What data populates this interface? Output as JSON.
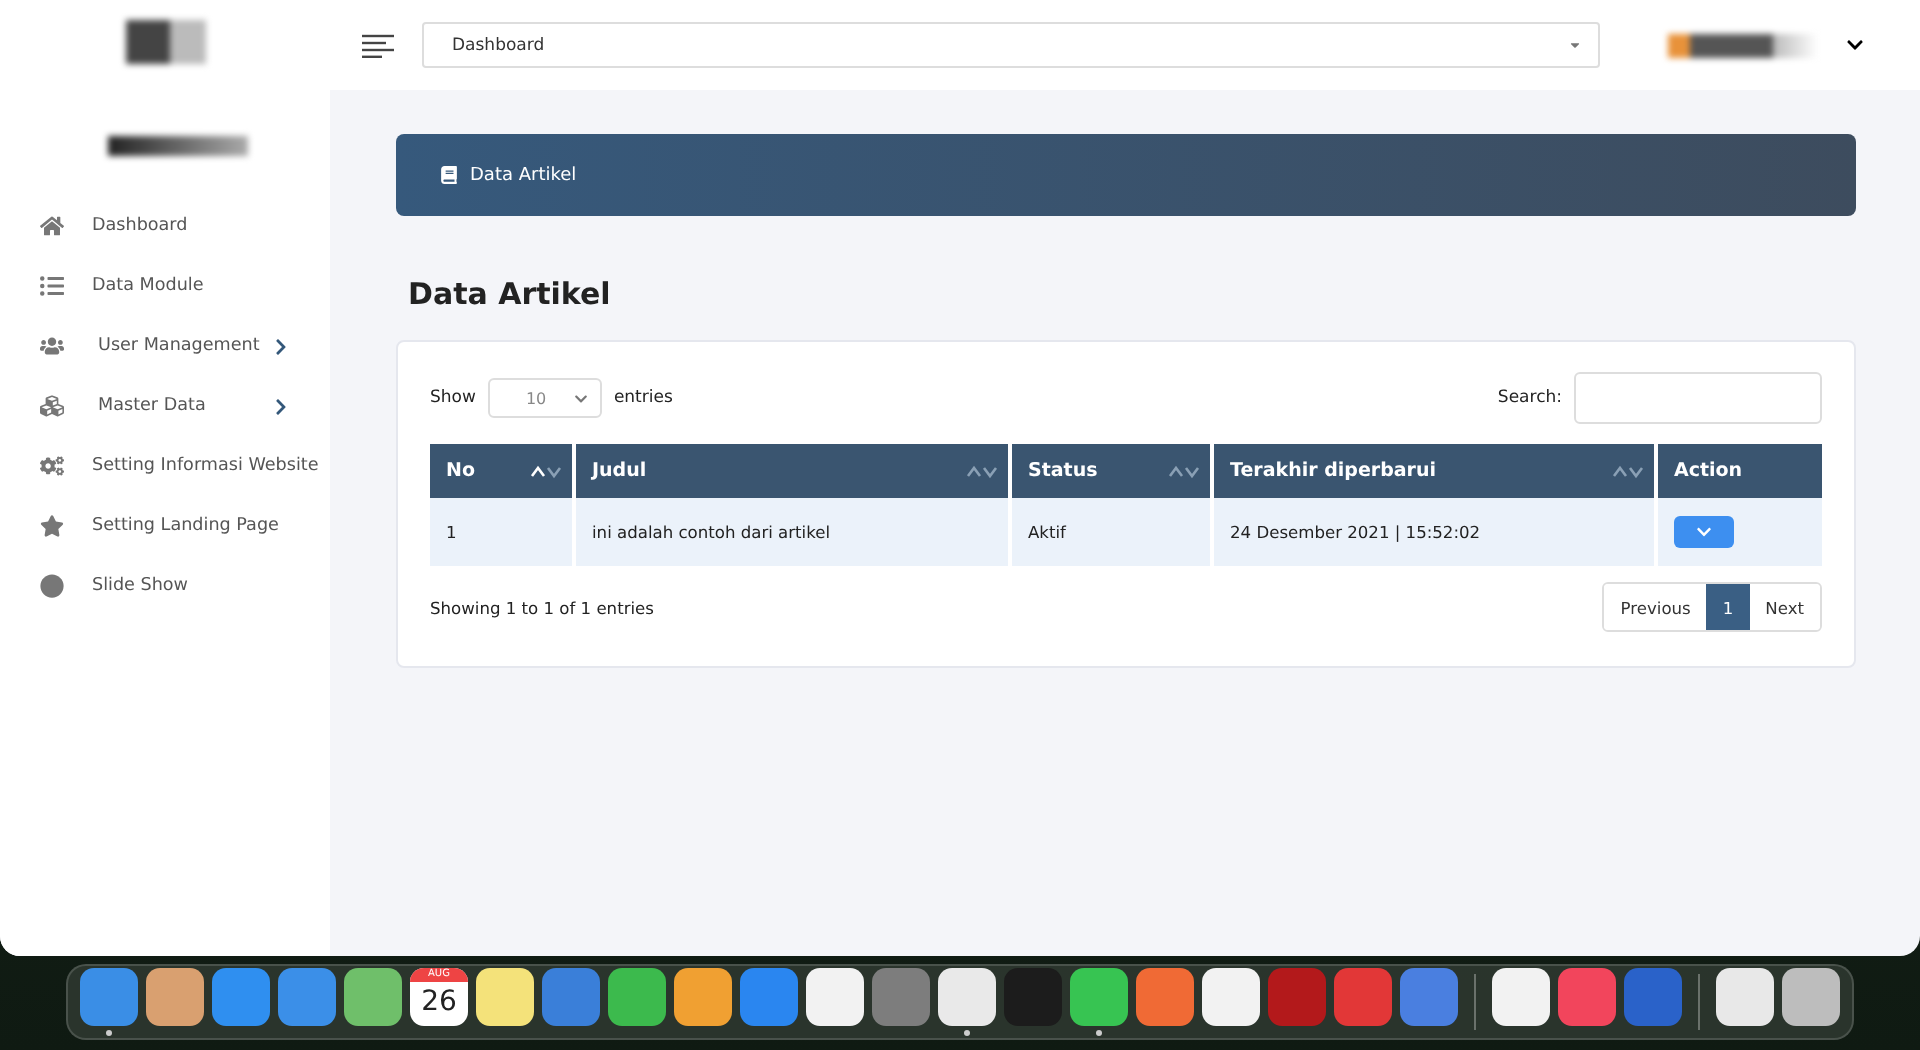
{
  "topbar": {
    "page_select": "Dashboard"
  },
  "sidebar": {
    "items": [
      {
        "label": "Dashboard",
        "has_submenu": false
      },
      {
        "label": "Data Module",
        "has_submenu": false
      },
      {
        "label": "User Management",
        "has_submenu": true
      },
      {
        "label": "Master Data",
        "has_submenu": true
      },
      {
        "label": "Setting Informasi Website",
        "has_submenu": false
      },
      {
        "label": "Setting Landing Page",
        "has_submenu": false
      },
      {
        "label": "Slide Show",
        "has_submenu": false
      }
    ]
  },
  "breadcrumb": {
    "label": "Data Artikel"
  },
  "heading": "Data Artikel",
  "table_controls": {
    "show_label": "Show",
    "page_size": "10",
    "entries_label": "entries",
    "search_label": "Search:"
  },
  "table": {
    "columns": [
      {
        "label": "No",
        "sortable": true,
        "sorted": true
      },
      {
        "label": "Judul",
        "sortable": true,
        "sorted": false
      },
      {
        "label": "Status",
        "sortable": true,
        "sorted": false
      },
      {
        "label": "Terakhir diperbarui",
        "sortable": true,
        "sorted": false
      },
      {
        "label": "Action",
        "sortable": false
      }
    ],
    "rows": [
      [
        "1",
        "ini adalah contoh dari artikel",
        "Aktif",
        "24 Desember 2021 | 15:52:02"
      ]
    ]
  },
  "info": "Showing 1 to 1 of 1 entries",
  "pagination": [
    {
      "label": "Previous",
      "selected": false
    },
    {
      "label": "1",
      "selected": true
    },
    {
      "label": "Next",
      "selected": false
    }
  ],
  "dock": {
    "groups": [
      [
        {
          "color": "#3a8ee6",
          "running": true
        },
        {
          "color": "#d9a070",
          "running": false
        },
        {
          "color": "#2f8ff0",
          "running": false
        },
        {
          "color": "#3b8fe8",
          "running": false
        },
        {
          "color": "#6fbf6a",
          "running": false
        },
        {
          "color": "#ffffff",
          "running": false,
          "kind": "calendar",
          "month": "AUG",
          "day": "26"
        },
        {
          "color": "#f4e27a",
          "running": false
        },
        {
          "color": "#3a7fd9",
          "running": false
        },
        {
          "color": "#3cba4d",
          "running": false
        },
        {
          "color": "#f0a032",
          "running": false
        },
        {
          "color": "#2a86f0",
          "running": false
        },
        {
          "color": "#f2f2f2",
          "running": false
        },
        {
          "color": "#7d7d7d",
          "running": false
        },
        {
          "color": "#e9e9e9",
          "running": true
        },
        {
          "color": "#1c1c1c",
          "running": false
        },
        {
          "color": "#37c452",
          "running": true
        },
        {
          "color": "#f06a35",
          "running": false
        },
        {
          "color": "#f2f2f2",
          "running": false
        },
        {
          "color": "#b3191b",
          "running": false
        },
        {
          "color": "#e23737",
          "running": false
        },
        {
          "color": "#4a7fe0",
          "running": false
        }
      ],
      [
        {
          "color": "#f2f2f2",
          "running": false
        },
        {
          "color": "#f2455c",
          "running": false
        },
        {
          "color": "#2a62c9",
          "running": false
        }
      ],
      [
        {
          "color": "#e8e8e8",
          "running": false
        },
        {
          "color": "#bdbdbd",
          "running": false
        }
      ]
    ]
  }
}
